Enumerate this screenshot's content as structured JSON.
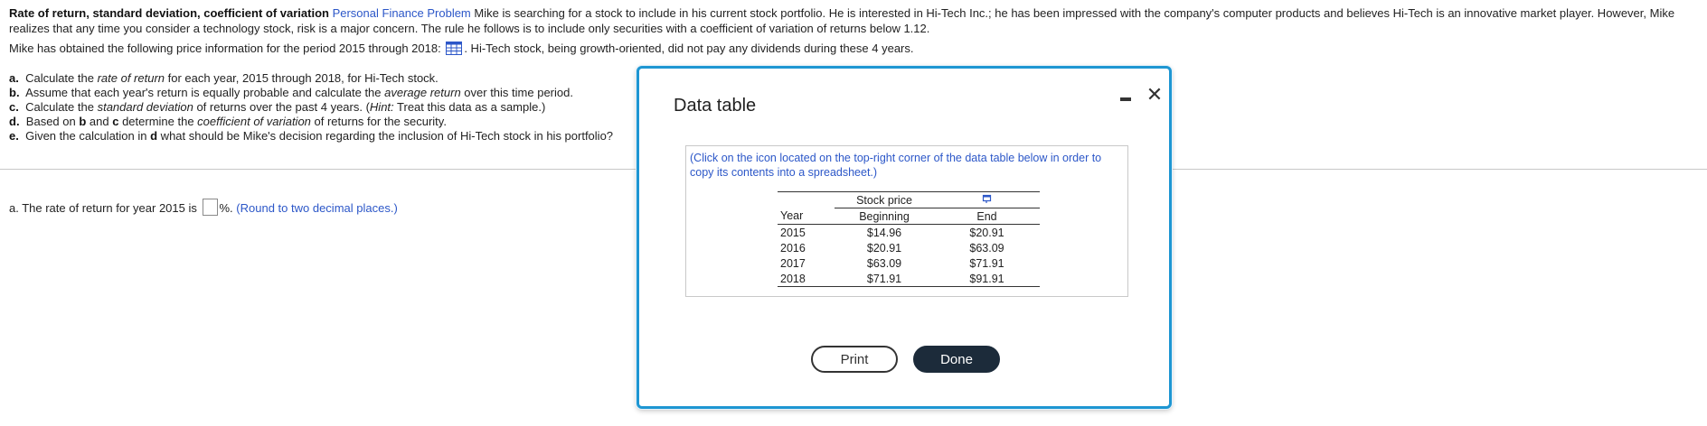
{
  "problem": {
    "title": "Rate of return, standard deviation, coefficient of variation",
    "source_link": "Personal Finance Problem",
    "intro_line1": "Mike is searching for a stock to include in his current stock portfolio.  He is interested in Hi-Tech Inc.; he has been impressed with the company's computer products and believes Hi-Tech is an innovative market player.  However, Mike",
    "intro_line2": "realizes that any time you consider a technology stock, risk is a major concern.  The rule he follows is to include only securities with a coefficient of variation of returns below 1.12.",
    "info_before": "Mike has obtained the following price information for the period 2015 through 2018:",
    "info_after": ". Hi-Tech stock, being growth-oriented, did not pay any dividends during these 4 years."
  },
  "tasks": [
    {
      "letter": "a.",
      "pre": "Calculate the ",
      "em": "rate of return",
      "post": " for each year, 2015 through 2018, for Hi-Tech stock."
    },
    {
      "letter": "b.",
      "pre": "Assume that each year's return is equally probable and calculate the ",
      "em": "average return",
      "post": " over this time period."
    },
    {
      "letter": "c.",
      "pre": "Calculate the ",
      "em": "standard deviation",
      "post": " of returns over the past 4 years.  (",
      "hint": "Hint:",
      "post2": " Treat this data as a sample.)"
    },
    {
      "letter": "d.",
      "pre": "Based on ",
      "b1": "b",
      "mid": " and ",
      "b2": "c",
      "mid2": " determine the ",
      "em": "coefficient of variation",
      "post": " of returns for the security."
    },
    {
      "letter": "e.",
      "pre": "Given the calculation in ",
      "b1": "d",
      "post": " what should be Mike's decision regarding the inclusion of Hi-Tech stock in his portfolio?"
    }
  ],
  "answer": {
    "prefix": "a.  The rate of return for year 2015 is",
    "value": "",
    "suffix": "%.",
    "note": "(Round to two decimal places.)"
  },
  "modal": {
    "title": "Data table",
    "close_glyph": "✕",
    "instruction": "(Click on the icon located on the top-right corner of the data table below in order to copy its contents into a spreadsheet.)",
    "table": {
      "group_header": "Stock price",
      "col_year": "Year",
      "col_begin": "Beginning",
      "col_end": "End",
      "rows": [
        {
          "year": "2015",
          "begin": "$14.96",
          "end": "$20.91"
        },
        {
          "year": "2016",
          "begin": "$20.91",
          "end": "$63.09"
        },
        {
          "year": "2017",
          "begin": "$63.09",
          "end": "$71.91"
        },
        {
          "year": "2018",
          "begin": "$71.91",
          "end": "$91.91"
        }
      ]
    },
    "print_label": "Print",
    "done_label": "Done"
  },
  "colors": {
    "link": "#2c57c8",
    "modal_border": "#1e96d2",
    "done_bg": "#1c2b3a"
  }
}
